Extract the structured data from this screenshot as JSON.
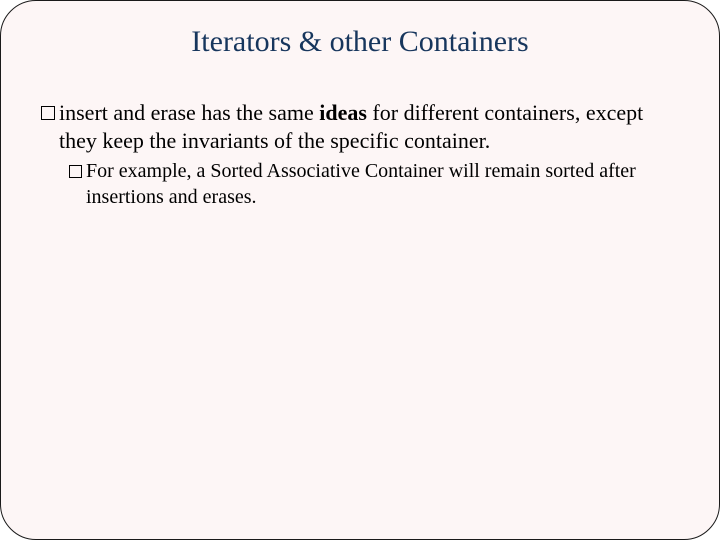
{
  "slide": {
    "title": "Iterators & other Containers",
    "bullets": [
      {
        "pre": "insert and erase has the same ",
        "bold": "ideas",
        "post": " for different containers, except they keep the invariants of the specific container.",
        "children": [
          {
            "text": "For example, a Sorted Associative Container  will remain sorted after insertions and erases."
          }
        ]
      }
    ]
  }
}
